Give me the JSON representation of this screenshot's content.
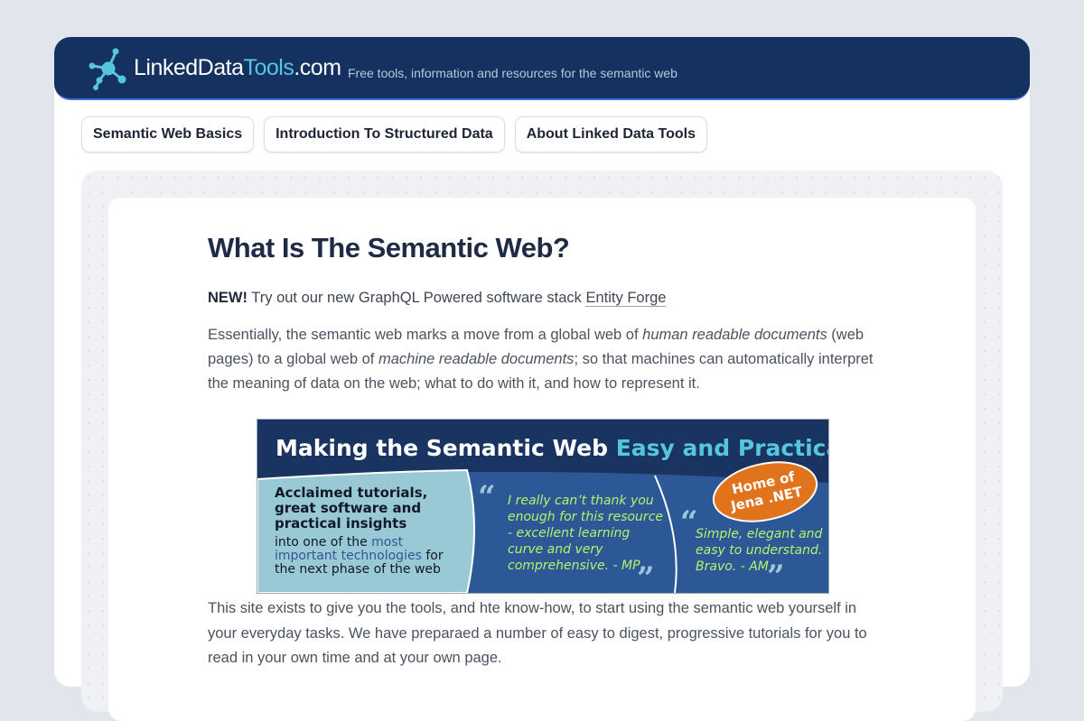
{
  "header": {
    "logo": {
      "part1": "LinkedData",
      "part2": "Tools",
      "part3": ".com"
    },
    "tagline": "Free tools, information and resources for the semantic web"
  },
  "nav": {
    "items": [
      {
        "label": "Semantic Web Basics"
      },
      {
        "label": "Introduction To Structured Data"
      },
      {
        "label": "About Linked Data Tools"
      }
    ]
  },
  "article": {
    "title": "What Is The Semantic Web?",
    "new_badge": "NEW!",
    "new_text": " Try out our new GraphQL Powered software stack ",
    "new_link": "Entity Forge",
    "intro": {
      "t1": "Essentially, the semantic web marks a move from a global web of ",
      "em1": "human readable documents",
      "t2": " (web pages) to a global web of ",
      "em2": "machine readable documents",
      "t3": "; so that machines can automatically interpret the meaning of data on the web; what to do with it, and how to represent it."
    },
    "banner": {
      "title_a": "Making the Semantic Web ",
      "title_b": "Easy and Practical",
      "left_bold_1": "Acclaimed tutorials,",
      "left_bold_2": "great software and",
      "left_bold_3": "practical insights",
      "left_line_4a": "into one of the ",
      "left_line_4b": "most",
      "left_line_5a": "important technologies",
      "left_line_5b": " for",
      "left_line_6": "the next phase of the web",
      "quote1_lines": [
        "I really can’t thank you",
        "enough for this resource",
        "- excellent learning",
        "curve and very",
        "comprehensive. - MP"
      ],
      "quote2_lines": [
        "Simple, elegant and",
        "easy to understand.",
        "Bravo. - AM"
      ],
      "badge_line1": "Home of",
      "badge_line2": "Jena .NET"
    },
    "body": "This site exists to give you the tools, and hte know-how, to start using the semantic web yourself in your everyday tasks. We have preparaed a number of easy to digest, progressive tutorials for you to read in your own time and at your own page."
  },
  "colors": {
    "masthead": "#14315f",
    "accent": "#55c5e0",
    "banner_navy": "#1a3461",
    "banner_mid": "#2d5897",
    "banner_light": "#9ac9d6",
    "quote_green": "#b4f36a",
    "badge_orange": "#e0731c"
  }
}
